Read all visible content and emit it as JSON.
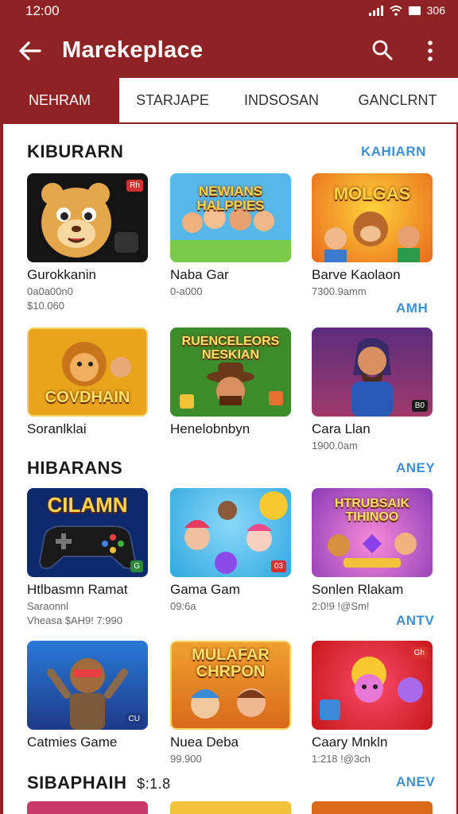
{
  "status": {
    "time": "12:00",
    "right_text": "306"
  },
  "appbar": {
    "title": "Marekeplace"
  },
  "tabs": [
    {
      "label": "NEHRAM",
      "active": true
    },
    {
      "label": "STARJAPE",
      "active": false
    },
    {
      "label": "INDSOSAN",
      "active": false
    },
    {
      "label": "GANCLRNT",
      "active": false
    }
  ],
  "sections": [
    {
      "title": "KIBURARN",
      "more": "KAHIARN",
      "items": [
        {
          "name": "Gurokkanin",
          "sub1": "0a0a00n0",
          "sub2": "$10.060",
          "banner": "",
          "badge": "Rh",
          "bg": "#141414"
        },
        {
          "name": "Naba Gar",
          "sub1": "0-a000",
          "sub2": "",
          "banner": "NEWIANS HALPPIES",
          "badge": "",
          "bg": "#56b8e8"
        },
        {
          "name": "Barve Kaolaon",
          "sub1": "7300.9amm",
          "sub2": "",
          "banner": "MOLGAS",
          "badge": "",
          "bg": "#e86a1c"
        }
      ],
      "row_more": "AMH"
    },
    {
      "title": "",
      "more": "",
      "items": [
        {
          "name": "Soranlklai",
          "sub1": "",
          "sub2": "",
          "banner": "COVDHAIN",
          "badge": "",
          "bg": "#e8a41a"
        },
        {
          "name": "Henelobnbyn",
          "sub1": "",
          "sub2": "",
          "banner": "RUENCELEORS NESKIAN",
          "badge": "",
          "bg": "#3c8c2c"
        },
        {
          "name": "Cara Llan",
          "sub1": "1900.0am",
          "sub2": "",
          "banner": "",
          "badge": "B0",
          "bg": "#5b2c7e"
        }
      ],
      "row_more": ""
    },
    {
      "title": "HIBARANS",
      "more": "ANEY",
      "items": [
        {
          "name": "Htlbasmn Ramat",
          "sub1": "Saraonnl",
          "sub2": "Vheasa $AH9! 7:990",
          "banner": "CILAMN",
          "badge": "G",
          "bg": "#0e2a6e"
        },
        {
          "name": "Gama Gam",
          "sub1": "09:6a",
          "sub2": "",
          "banner": "",
          "badge": "03",
          "bg": "#2fa8e0"
        },
        {
          "name": "Sonlen Rlakam",
          "sub1": "2:0!9 !@Sm!",
          "sub2": "",
          "banner": "HTRUBSAIK TIHINOO",
          "badge": "",
          "bg": "#8a3ab8"
        }
      ],
      "row_more": "ANTV"
    },
    {
      "title": "",
      "more": "",
      "items": [
        {
          "name": "Catmies Game",
          "sub1": "",
          "sub2": "",
          "banner": "",
          "badge": "CU",
          "bg": "#1e5aa8"
        },
        {
          "name": "Nuea Deba",
          "sub1": "99.900",
          "sub2": "",
          "banner": "MULAFAR CHRPON",
          "badge": "",
          "bg": "#d86a1a"
        },
        {
          "name": "Caary Mnkln",
          "sub1": "1:218 !@3ch",
          "sub2": "",
          "banner": "",
          "badge": "Gh",
          "bg": "#d8201a"
        }
      ],
      "row_more": ""
    }
  ],
  "footer_section": {
    "title": "SIBAPHAIH",
    "count": "$:1.8",
    "more": "ANEV"
  },
  "colors": {
    "brand": "#8f2323",
    "link": "#3d8fd6"
  },
  "icons": [
    "back-arrow-icon",
    "search-icon",
    "more-vert-icon",
    "signal-icon",
    "wifi-icon",
    "battery-icon"
  ]
}
